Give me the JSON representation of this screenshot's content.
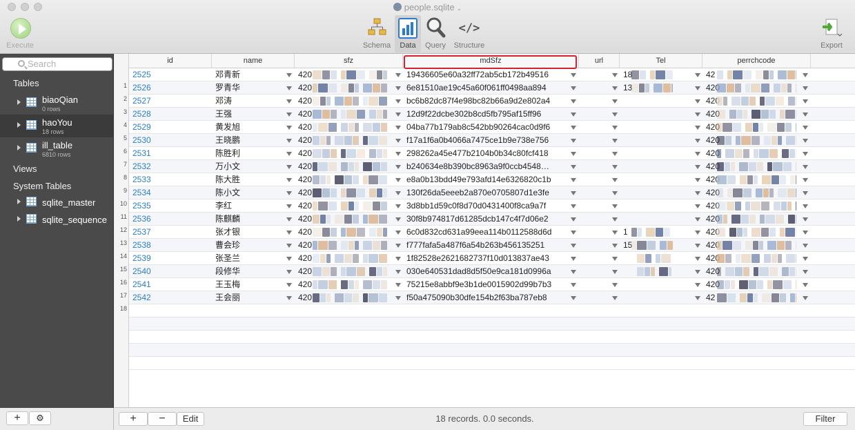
{
  "window": {
    "title": "people.sqlite"
  },
  "toolbar": {
    "execute": "Execute",
    "schema": "Schema",
    "data": "Data",
    "query": "Query",
    "structure": "Structure",
    "export": "Export"
  },
  "sidebar": {
    "search_placeholder": "Search",
    "tables_header": "Tables",
    "tables": [
      {
        "name": "biaoQian",
        "rows": "0 rows"
      },
      {
        "name": "haoYou",
        "rows": "18 rows"
      },
      {
        "name": "ill_table",
        "rows": "6810 rows"
      }
    ],
    "views_header": "Views",
    "system_header": "System Tables",
    "system_tables": [
      {
        "name": "sqlite_master"
      },
      {
        "name": "sqlite_sequence"
      }
    ]
  },
  "grid": {
    "columns": [
      "id",
      "name",
      "sfz",
      "mdSfz",
      "url",
      "Tel",
      "perrchcode"
    ],
    "highlighted_column": "mdSfz",
    "rows": [
      {
        "id": "2525",
        "name": "邓青新",
        "sfz": "420",
        "md": "19436605e60a32ff72ab5cb172b49516",
        "tel": "18",
        "perr": "42"
      },
      {
        "id": "2526",
        "name": "罗青华",
        "sfz": "420",
        "md": "6e81510ae19c45a60f061ff0498aa894",
        "tel": "13",
        "perr": "420"
      },
      {
        "id": "2527",
        "name": "邓涛",
        "sfz": "420",
        "md": "bc6b82dc87f4e98bc82b66a9d2e802a4",
        "tel": "",
        "perr": "420"
      },
      {
        "id": "2528",
        "name": "王强",
        "sfz": "420",
        "md": "12d9f22dcbe302b8cd5fb795af15ff96",
        "tel": "",
        "perr": "420"
      },
      {
        "id": "2529",
        "name": "黄发旭",
        "sfz": "420",
        "md": "04ba77b179ab8c542bb90264cac0d9f6",
        "tel": "",
        "perr": "420"
      },
      {
        "id": "2530",
        "name": "王晓鹏",
        "sfz": "420",
        "md": "f17a1f6a0b4066a7475ce1b9e738e756",
        "tel": "",
        "perr": "420"
      },
      {
        "id": "2531",
        "name": "陈胜利",
        "sfz": "420",
        "md": "298262a45e477b2104b0b34c80fcf418",
        "tel": "",
        "perr": "420"
      },
      {
        "id": "2532",
        "name": "万小文",
        "sfz": "420",
        "md": "b240634e8b390bc8963a9f0ccb4548…",
        "tel": "",
        "perr": "420"
      },
      {
        "id": "2533",
        "name": "陈大胜",
        "sfz": "420",
        "md": "e8a0b13bdd49e793afd14e6326820c1b",
        "tel": "",
        "perr": "420"
      },
      {
        "id": "2534",
        "name": "陈小文",
        "sfz": "420",
        "md": "130f26da5eeeb2a870e0705807d1e3fe",
        "tel": "",
        "perr": "420"
      },
      {
        "id": "2535",
        "name": "李红",
        "sfz": "420",
        "md": "3d8bb1d59c0f8d70d0431400f8ca9a7f",
        "tel": "",
        "perr": "420"
      },
      {
        "id": "2536",
        "name": "陈麒麟",
        "sfz": "420",
        "md": "30f8b974817d61285dcb147c4f7d06e2",
        "tel": "",
        "perr": "420"
      },
      {
        "id": "2537",
        "name": "张才银",
        "sfz": "420",
        "md": "6c0d832cd631a99eea114b0112588d6d",
        "tel": "1",
        "perr": "420"
      },
      {
        "id": "2538",
        "name": "曹会珍",
        "sfz": "420",
        "md": "f777fafa5a487f6a54b263b456135251",
        "tel": "15",
        "perr": "420"
      },
      {
        "id": "2539",
        "name": "张圣兰",
        "sfz": "420",
        "md": "1f82528e2621682737f10d013837ae43",
        "tel": "",
        "perr": "420"
      },
      {
        "id": "2540",
        "name": "段修华",
        "sfz": "420",
        "md": "030e640531dad8d5f50e9ca181d0996a",
        "tel": "",
        "perr": "420"
      },
      {
        "id": "2541",
        "name": "王玉梅",
        "sfz": "420",
        "md": "75215e8abbf9e3b1de0015902d99b7b3",
        "tel": "",
        "perr": "420"
      },
      {
        "id": "2542",
        "name": "王会丽",
        "sfz": "420",
        "md": "f50a475090b30dfe154b2f63ba787eb8",
        "tel": "",
        "perr": "42"
      }
    ],
    "row_numbers": [
      "1",
      "2",
      "3",
      "4",
      "5",
      "6",
      "7",
      "8",
      "9",
      "10",
      "11",
      "12",
      "13",
      "14",
      "15",
      "16",
      "17",
      "18"
    ]
  },
  "statusbar": {
    "add": "+",
    "remove": "−",
    "edit": "Edit",
    "message": "18 records. 0.0 seconds.",
    "filter": "Filter"
  }
}
